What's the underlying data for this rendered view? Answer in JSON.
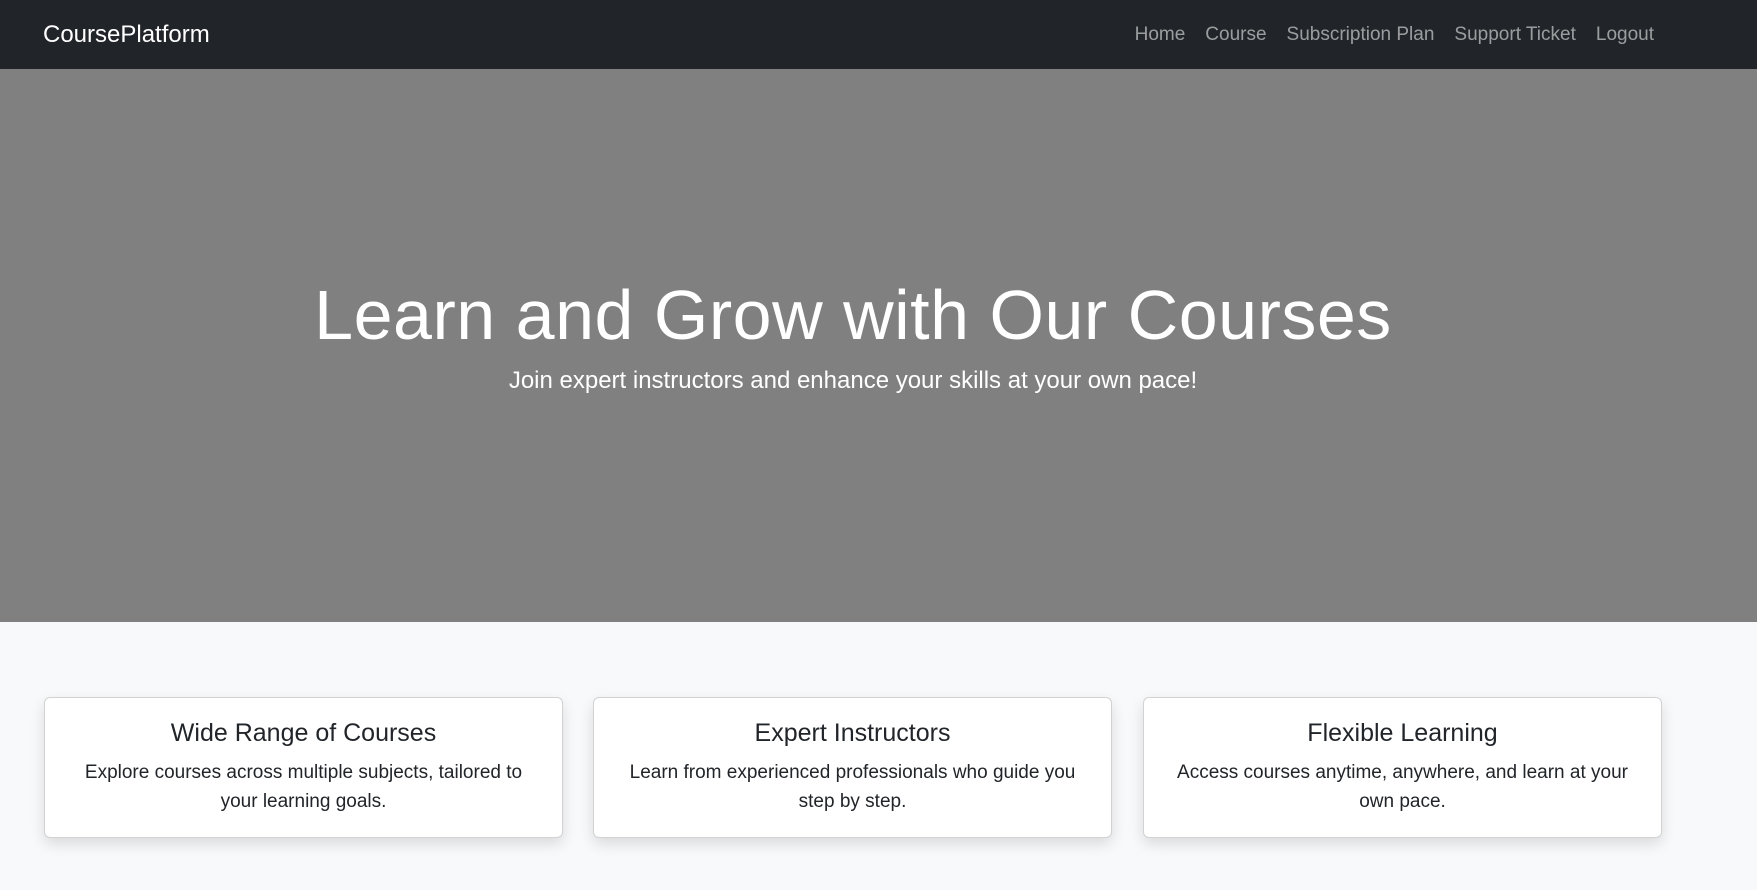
{
  "navbar": {
    "brand": "CoursePlatform",
    "links": [
      "Home",
      "Course",
      "Subscription Plan",
      "Support Ticket",
      "Logout"
    ]
  },
  "hero": {
    "title": "Learn and Grow with Our Courses",
    "subtitle": "Join expert instructors and enhance your skills at your own pace!"
  },
  "features": [
    {
      "title": "Wide Range of Courses",
      "text": "Explore courses across multiple subjects, tailored to your learning goals."
    },
    {
      "title": "Expert Instructors",
      "text": "Learn from experienced professionals who guide you step by step."
    },
    {
      "title": "Flexible Learning",
      "text": "Access courses anytime, anywhere, and learn at your own pace."
    }
  ],
  "colors": {
    "navbar_bg": "#212529",
    "hero_bg": "#808080",
    "page_bg": "#f8f9fa"
  }
}
